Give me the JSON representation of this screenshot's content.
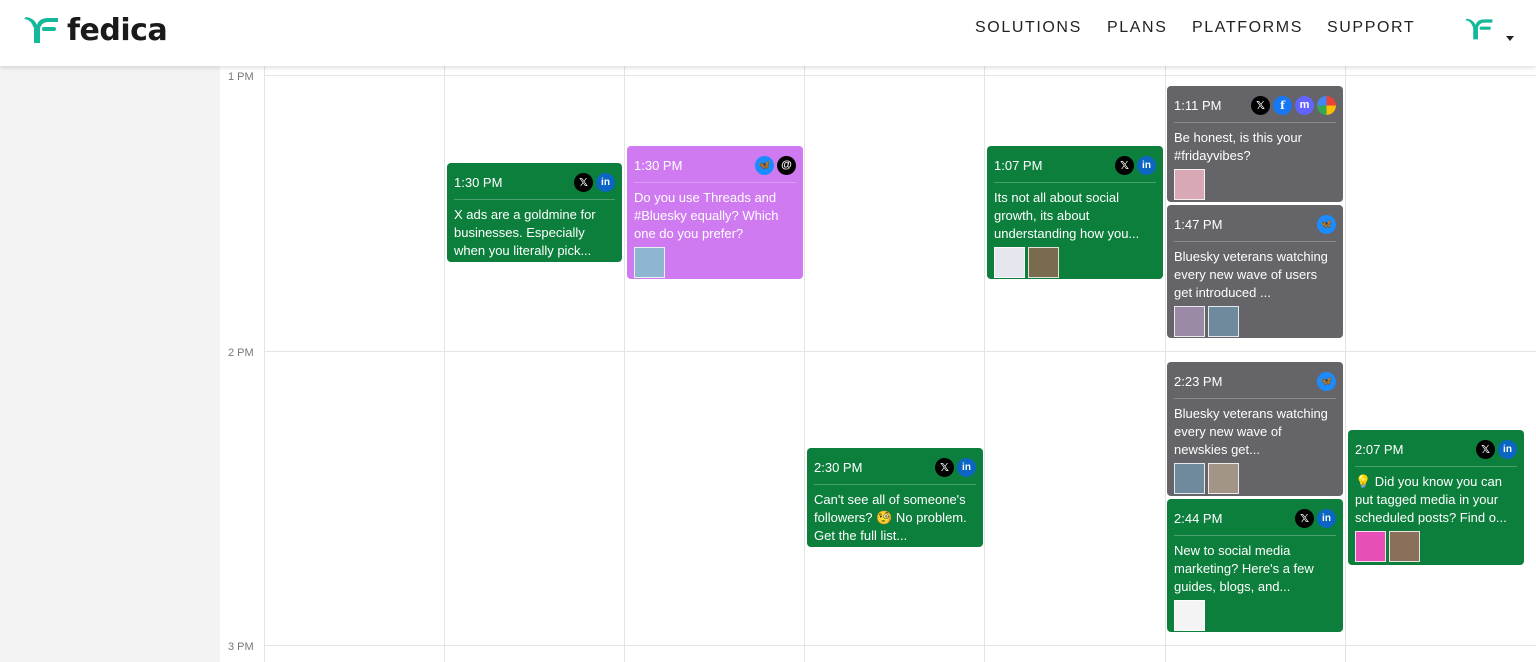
{
  "header": {
    "logo_text": "fedica",
    "nav": [
      "SOLUTIONS",
      "PLANS",
      "PLATFORMS",
      "SUPPORT"
    ]
  },
  "calendar": {
    "hours": [
      "1 PM",
      "2 PM",
      "3 PM"
    ]
  },
  "events": [
    {
      "time": "1:30 PM",
      "color": "green",
      "platforms": [
        "x-icon",
        "linkedin-icon"
      ],
      "text": "X ads are a goldmine for businesses. Especially when you literally pick...",
      "thumbs": []
    },
    {
      "time": "1:30 PM",
      "color": "purple",
      "platforms": [
        "bluesky-icon",
        "threads-icon"
      ],
      "text": "Do you use Threads and #Bluesky equally? Which one do you prefer?",
      "thumbs": [
        "#8fb6d0"
      ]
    },
    {
      "time": "1:07 PM",
      "color": "green",
      "platforms": [
        "x-icon",
        "linkedin-icon"
      ],
      "text": "Its not all about social growth, its about understanding how you...",
      "thumbs": [
        "#e6e6ee",
        "#7a6a4e"
      ]
    },
    {
      "time": "1:11 PM",
      "color": "gray",
      "platforms": [
        "x-icon",
        "facebook-icon",
        "mastodon-icon",
        "pinterest-icon"
      ],
      "text": "Be honest, is this your #fridayvibes?",
      "thumbs": [
        "#d8a8b4"
      ]
    },
    {
      "time": "1:47 PM",
      "color": "gray",
      "platforms": [
        "bluesky-icon"
      ],
      "text": "Bluesky veterans watching every new wave of users get introduced ...",
      "thumbs": [
        "#9a8aa6",
        "#6f8a9c"
      ]
    },
    {
      "time": "2:23 PM",
      "color": "gray",
      "platforms": [
        "bluesky-icon"
      ],
      "text": "Bluesky veterans watching every new wave of newskies get...",
      "thumbs": [
        "#6f8a9c",
        "#a39488"
      ]
    },
    {
      "time": "2:30 PM",
      "color": "green",
      "platforms": [
        "x-icon",
        "linkedin-icon"
      ],
      "text": "Can't see all of someone's followers? 🧐 No problem. Get the full list...",
      "thumbs": []
    },
    {
      "time": "2:44 PM",
      "color": "green",
      "platforms": [
        "x-icon",
        "linkedin-icon"
      ],
      "text": "New to social media marketing? Here's a few guides, blogs, and...",
      "thumbs": [
        "#f4f4f4"
      ]
    },
    {
      "time": "2:07 PM",
      "color": "green",
      "platforms": [
        "x-icon",
        "linkedin-icon"
      ],
      "text": "💡 Did you know you can put tagged media in your scheduled posts? Find o...",
      "thumbs": [
        "#e84fb6",
        "#8a6f5a"
      ]
    }
  ]
}
